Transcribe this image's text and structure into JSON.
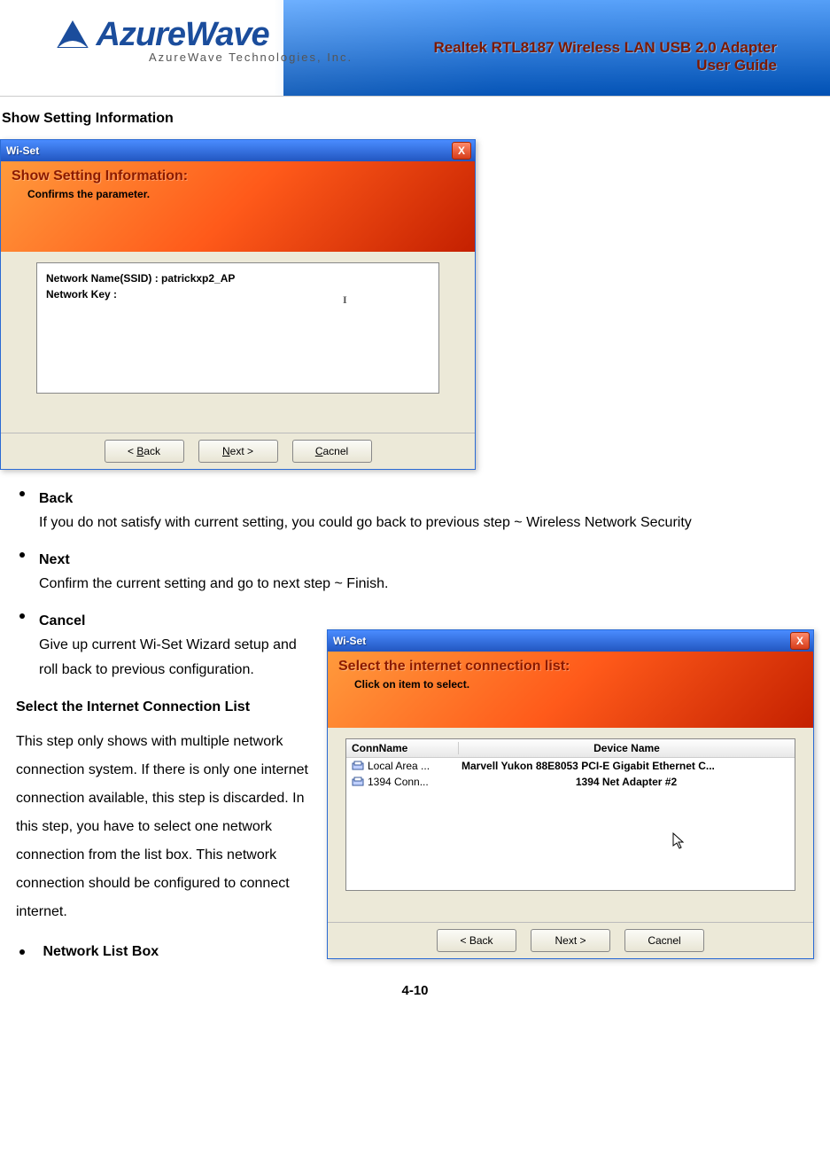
{
  "header": {
    "logo_main": "AzureWave",
    "logo_sub": "AzureWave  Technologies,  Inc.",
    "product_line1": "Realtek RTL8187 Wireless LAN USB 2.0 Adapter",
    "product_line2": "User Guide"
  },
  "section1_title": "Show Setting Information",
  "dialog1": {
    "title": "Wi-Set",
    "close": "X",
    "header_title": "Show Setting Information:",
    "header_sub": "Confirms the parameter.",
    "info_line1": "Network Name(SSID) : patrickxp2_AP",
    "info_line2": "Network Key :",
    "btn_back": "< Back",
    "btn_next": "Next >",
    "btn_cancel": "Cacnel"
  },
  "bullets": {
    "back": {
      "title": "Back",
      "body": "If you do not satisfy with current setting, you could go back to previous step ~ Wireless Network Security"
    },
    "next": {
      "title": "Next",
      "body": "Confirm the current setting and go to next step ~ Finish."
    },
    "cancel": {
      "title": "Cancel",
      "body": "Give up current Wi-Set Wizard setup and roll back to previous configuration."
    },
    "netlist_title": "Network List Box"
  },
  "section2_title": "Select the Internet Connection List",
  "section2_body": "This step only shows with multiple network connection system. If there is only one internet connection available, this step is discarded. In this step, you have to select one network connection from the list box. This network connection should be configured to connect internet.",
  "dialog2": {
    "title": "Wi-Set",
    "close": "X",
    "header_title": "Select the internet connection list:",
    "header_sub": "Click on item to select.",
    "col_conn": "ConnName",
    "col_dev": "Device Name",
    "rows": [
      {
        "conn": "Local Area ...",
        "dev": "Marvell Yukon 88E8053 PCI-E Gigabit Ethernet C..."
      },
      {
        "conn": "1394 Conn...",
        "dev": "1394 Net Adapter #2"
      }
    ],
    "btn_back": "< Back",
    "btn_next": "Next >",
    "btn_cancel": "Cacnel"
  },
  "page_num": "4-10"
}
